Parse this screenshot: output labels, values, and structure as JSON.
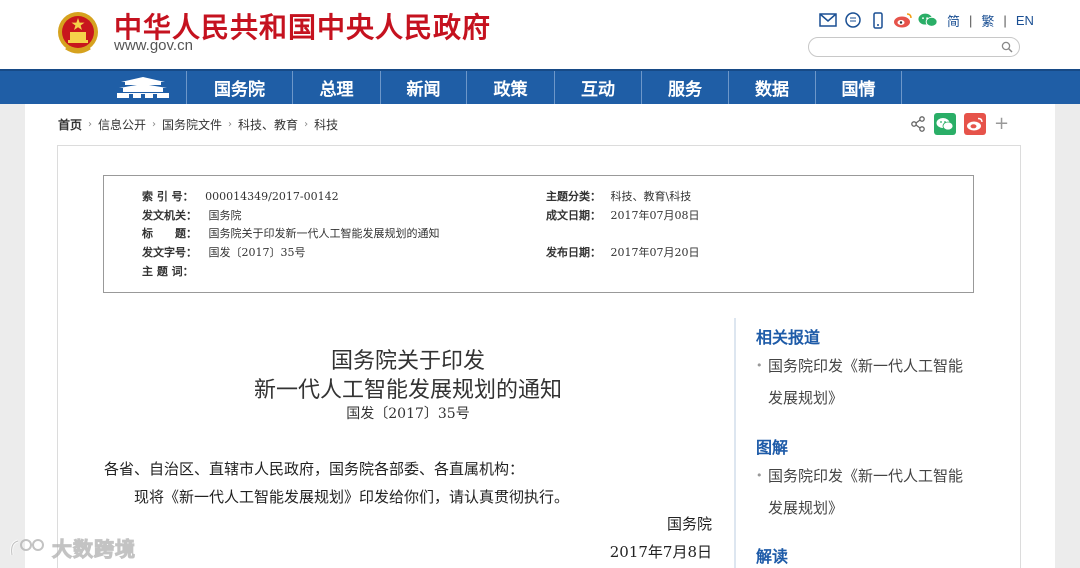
{
  "header": {
    "site_title": "中华人民共和国中央人民政府",
    "site_url": "www.gov.cn",
    "lang_simplified": "简",
    "lang_traditional": "繁",
    "lang_english": "EN",
    "lang_separator": "|",
    "search_placeholder": "",
    "icons": [
      "mail-icon",
      "message-icon",
      "mobile-icon",
      "weibo-icon",
      "wechat-icon"
    ]
  },
  "nav": {
    "items": [
      "国务院",
      "总理",
      "新闻",
      "政策",
      "互动",
      "服务",
      "数据",
      "国情"
    ]
  },
  "breadcrumb": {
    "items": [
      "首页",
      "信息公开",
      "国务院文件",
      "科技、教育",
      "科技"
    ],
    "separator": "›"
  },
  "meta": {
    "index_label": "索 引 号：",
    "index_value": "000014349/2017-00142",
    "topic_label": "主题分类：",
    "topic_value": "科技、教育\\科技",
    "issuer_label": "发文机关：",
    "issuer_value": "国务院",
    "written_label": "成文日期：",
    "written_value": "2017年07月08日",
    "title_label": "标　　题：",
    "title_value": "国务院关于印发新一代人工智能发展规划的通知",
    "docno_label": "发文字号：",
    "docno_value": "国发〔2017〕35号",
    "publish_label": "发布日期：",
    "publish_value": "2017年07月20日",
    "keywords_label": "主 题 词："
  },
  "document": {
    "title_line1": "国务院关于印发",
    "title_line2": "新一代人工智能发展规划的通知",
    "number": "国发〔2017〕35号",
    "para1": "各省、自治区、直辖市人民政府，国务院各部委、各直属机构：",
    "para2": "现将《新一代人工智能发展规划》印发给你们，请认真贯彻执行。",
    "signature": "国务院",
    "date": "2017年7月8日"
  },
  "sidebar": {
    "related_heading": "相关报道",
    "related_link_line1": "国务院印发《新一代人工智能",
    "related_link_line2": "发展规划》",
    "graphic_heading": "图解",
    "graphic_link_line1": "国务院印发《新一代人工智能",
    "graphic_link_line2": "发展规划》",
    "interpret_heading": "解读"
  },
  "watermark": {
    "text": "大数跨境"
  },
  "colors": {
    "brand_red": "#c5121f",
    "nav_blue": "#1f5ea6",
    "sidebar_heading": "#1e5ba8",
    "wechat_green": "#2aae67",
    "weibo_red": "#e6534a"
  }
}
